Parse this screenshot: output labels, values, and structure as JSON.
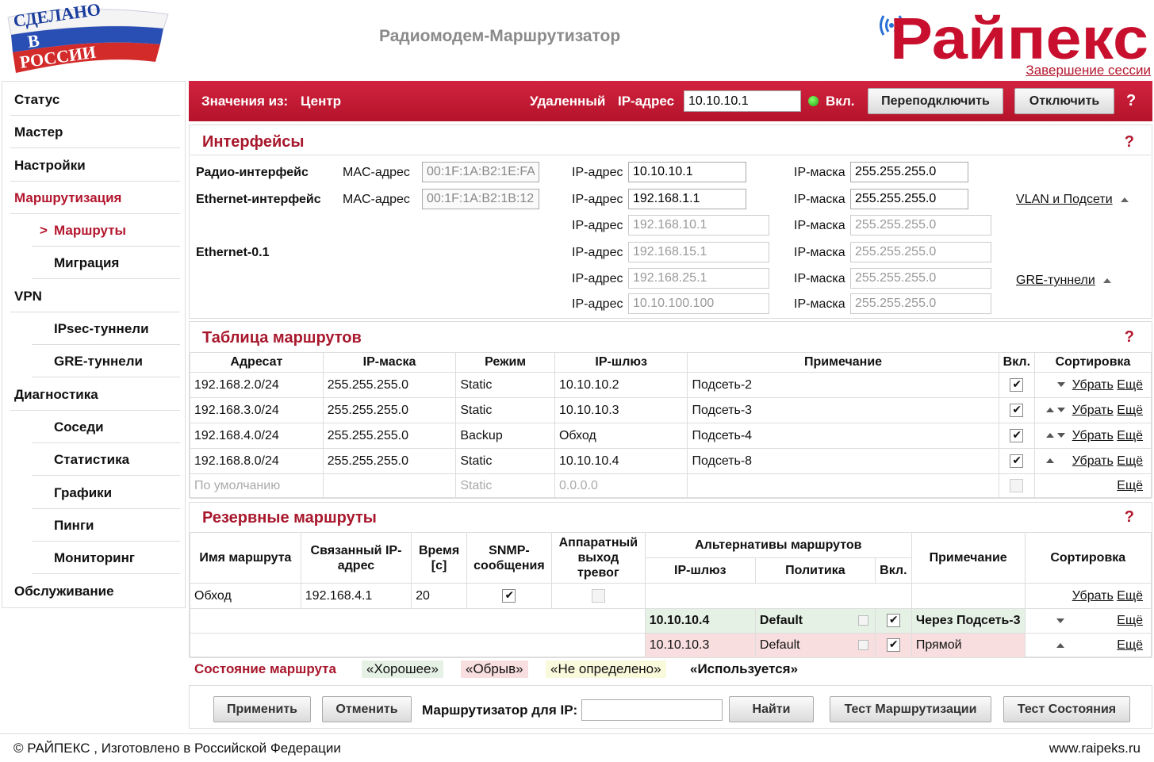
{
  "header": {
    "flag_logo_text": [
      "СДЕЛАНО",
      "В",
      "РОССИИ"
    ],
    "product_title": "Радиомодем-Маршрутизатор",
    "brand": "Райпекс",
    "logout": "Завершение сессии"
  },
  "sidebar": {
    "items": [
      {
        "label": "Статус"
      },
      {
        "label": "Мастер"
      },
      {
        "label": "Настройки"
      },
      {
        "label": "Маршрутизация"
      },
      {
        "label": "Маршруты",
        "prefix": ">"
      },
      {
        "label": "Миграция"
      },
      {
        "label": "VPN"
      },
      {
        "label": "IPsec-туннели"
      },
      {
        "label": "GRE-туннели"
      },
      {
        "label": "Диагностика"
      },
      {
        "label": "Соседи"
      },
      {
        "label": "Статистика"
      },
      {
        "label": "Графики"
      },
      {
        "label": "Пинги"
      },
      {
        "label": "Мониторинг"
      },
      {
        "label": "Обслуживание"
      }
    ]
  },
  "topbar": {
    "values_from_label": "Значения из:",
    "values_from": "Центр",
    "remote_label": "Удаленный",
    "ip_label": "IP-адрес",
    "remote_ip": "10.10.10.1",
    "on_label": "Вкл.",
    "reconnect": "Переподключить",
    "disconnect": "Отключить",
    "help": "?"
  },
  "interfaces": {
    "title": "Интерфейсы",
    "help": "?",
    "mac_label": "MAC-адрес",
    "ip_label": "IP-адрес",
    "mask_label": "IP-маска",
    "radio_label": "Радио-интерфейс",
    "radio_mac": "00:1F:1A:B2:1E:FA",
    "radio_ip": "10.10.10.1",
    "radio_mask": "255.255.255.0",
    "eth_label": "Ethernet-интерфейс",
    "eth_mac": "00:1F:1A:B2:1B:12",
    "eth_ip": "192.168.1.1",
    "eth_mask": "255.255.255.0",
    "vlan_link": "VLAN и Подсети",
    "sub_label": "Ethernet-0.1",
    "sub_rows": [
      {
        "ip": "192.168.10.1",
        "mask": "255.255.255.0"
      },
      {
        "ip": "192.168.15.1",
        "mask": "255.255.255.0"
      },
      {
        "ip": "192.168.25.1",
        "mask": "255.255.255.0"
      },
      {
        "ip": "10.10.100.100",
        "mask": "255.255.255.0"
      }
    ],
    "gre_link": "GRE-туннели"
  },
  "routes": {
    "title": "Таблица маршрутов",
    "help": "?",
    "headers": [
      "Адресат",
      "IP-маска",
      "Режим",
      "IP-шлюз",
      "Примечание",
      "Вкл.",
      "Сортировка"
    ],
    "rows": [
      {
        "dest": "192.168.2.0/24",
        "mask": "255.255.255.0",
        "mode": "Static",
        "gw": "10.10.10.2",
        "note": "Подсеть-2",
        "on": true,
        "up": false,
        "down": true,
        "remove": "Убрать",
        "more": "Ещё"
      },
      {
        "dest": "192.168.3.0/24",
        "mask": "255.255.255.0",
        "mode": "Static",
        "gw": "10.10.10.3",
        "note": "Подсеть-3",
        "on": true,
        "up": true,
        "down": true,
        "remove": "Убрать",
        "more": "Ещё"
      },
      {
        "dest": "192.168.4.0/24",
        "mask": "255.255.255.0",
        "mode": "Backup",
        "gw": "Обход",
        "note": "Подсеть-4",
        "on": true,
        "up": true,
        "down": true,
        "remove": "Убрать",
        "more": "Ещё"
      },
      {
        "dest": "192.168.8.0/24",
        "mask": "255.255.255.0",
        "mode": "Static",
        "gw": "10.10.10.4",
        "note": "Подсеть-8",
        "on": true,
        "up": true,
        "down": false,
        "remove": "Убрать",
        "more": "Ещё"
      }
    ],
    "default_row": {
      "dest": "По умолчанию",
      "mode": "Static",
      "gw": "0.0.0.0",
      "more": "Ещё"
    }
  },
  "backup": {
    "title": "Резервные маршруты",
    "help": "?",
    "headers": {
      "name": "Имя маршрута",
      "linked_ip": "Связанный IP-адрес",
      "time": "Время [с]",
      "snmp": "SNMP-сообщения",
      "hw_alarm": "Аппаратный выход тревог",
      "alternatives": "Альтернативы маршрутов",
      "gw": "IP-шлюз",
      "policy": "Политика",
      "on": "Вкл.",
      "note": "Примечание",
      "sort": "Сортировка"
    },
    "route": {
      "name": "Обход",
      "linked_ip": "192.168.4.1",
      "time": "20",
      "snmp": true,
      "hw_alarm": false,
      "remove": "Убрать",
      "more": "Ещё"
    },
    "alternatives": [
      {
        "gw": "10.10.10.4",
        "policy": "Default",
        "on": true,
        "note": "Через Подсеть-3",
        "state": "good",
        "more": "Ещё"
      },
      {
        "gw": "10.10.10.3",
        "policy": "Default",
        "on": true,
        "note": "Прямой",
        "state": "broken",
        "more": "Ещё"
      }
    ]
  },
  "legend": {
    "label": "Состояние маршрута",
    "good": "«Хорошее»",
    "broken": "«Обрыв»",
    "undefined": "«Не определено»",
    "used": "«Используется»",
    "colors": {
      "good": "#e6f1e6",
      "broken": "#f8dede",
      "undefined": "#f9f9dc"
    }
  },
  "bottombar": {
    "apply": "Применить",
    "cancel": "Отменить",
    "router_for_ip": "Маршрутизатор для IP:",
    "router_ip_value": "",
    "find": "Найти",
    "test_routing": "Тест Маршрутизации",
    "test_state": "Тест Состояния"
  },
  "footer": {
    "copyright": "© РАЙПЕКС , Изготовлено в Российской Федерации",
    "site": "www.raipeks.ru"
  },
  "colors": {
    "accent": "#b3172e",
    "topbar": "#c41c35",
    "good_row": "#e6f1e6",
    "broken_row": "#f8dede"
  }
}
